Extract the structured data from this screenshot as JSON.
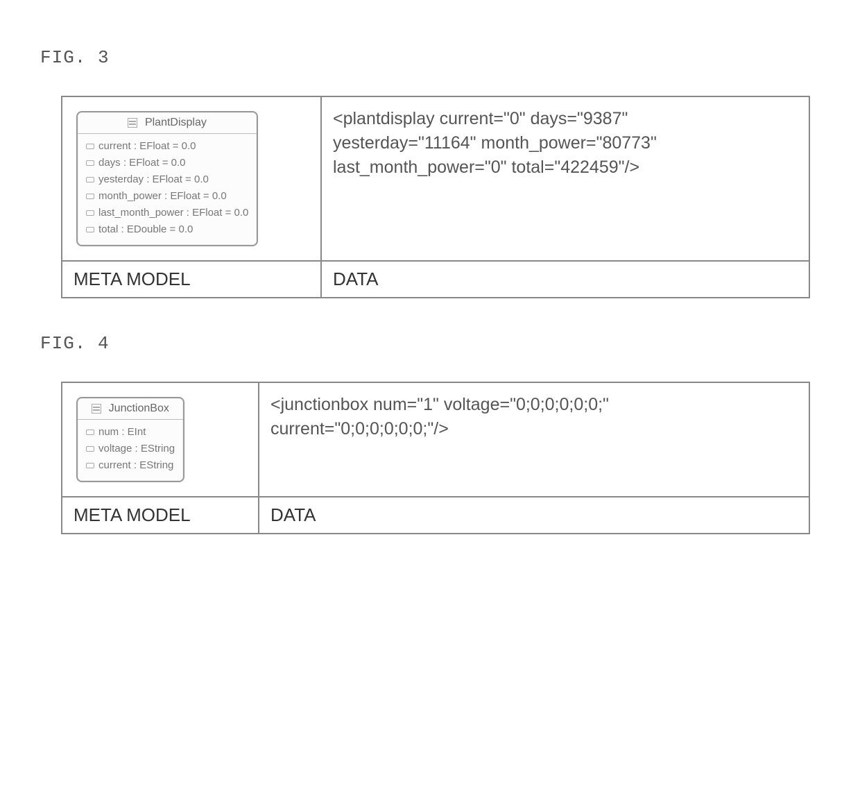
{
  "fig3": {
    "label": "FIG. 3",
    "meta_header": "META MODEL",
    "data_header": "DATA",
    "uml": {
      "class_name": "PlantDisplay",
      "attrs": [
        "current : EFloat = 0.0",
        "days : EFloat = 0.0",
        "yesterday : EFloat = 0.0",
        "month_power : EFloat = 0.0",
        "last_month_power : EFloat = 0.0",
        "total : EDouble = 0.0"
      ]
    },
    "data_line1": "<plantdisplay current=\"0\" days=\"9387\"",
    "data_line2": "yesterday=\"11164\" month_power=\"80773\"",
    "data_line3": "last_month_power=\"0\" total=\"422459\"/>"
  },
  "fig4": {
    "label": "FIG. 4",
    "meta_header": "META MODEL",
    "data_header": "DATA",
    "uml": {
      "class_name": "JunctionBox",
      "attrs": [
        "num : EInt",
        "voltage : EString",
        "current : EString"
      ]
    },
    "data_line1": "<junctionbox num=\"1\" voltage=\"0;0;0;0;0;0;\"",
    "data_line2": "current=\"0;0;0;0;0;0;\"/>"
  }
}
